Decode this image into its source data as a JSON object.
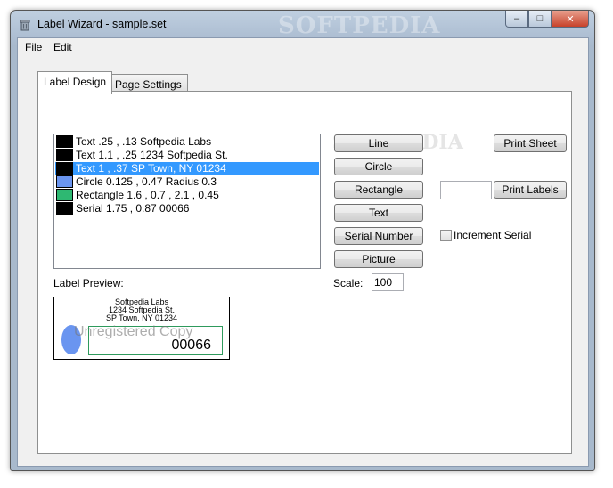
{
  "window": {
    "title": "Label Wizard - sample.set",
    "title_watermark": "SOFTPEDIA",
    "buttons": {
      "minimize": "–",
      "maximize": "□",
      "close": "✕"
    }
  },
  "menu": {
    "items": [
      "File",
      "Edit"
    ]
  },
  "tabs": [
    {
      "label": "Label Design",
      "active": true
    },
    {
      "label": "Page Settings",
      "active": false
    }
  ],
  "list": {
    "items": [
      {
        "text": "Text .25 , .13 Softpedia Labs",
        "color": "#000000",
        "selected": false
      },
      {
        "text": "Text 1.1 , .25 1234 Softpedia St.",
        "color": "#000000",
        "selected": false
      },
      {
        "text": "Text 1 , .37 SP Town, NY 01234",
        "color": "#000000",
        "selected": true
      },
      {
        "text": "Circle 0.125 , 0.47 Radius 0.3",
        "color": "#6a95f0",
        "selected": false
      },
      {
        "text": "Rectangle 1.6 , 0.7 , 2.1 , 0.45",
        "color": "#2eb872",
        "selected": false
      },
      {
        "text": "Serial 1.75 , 0.87 00066",
        "color": "#000000",
        "selected": false
      }
    ]
  },
  "tools": {
    "line": "Line",
    "circle": "Circle",
    "rectangle": "Rectangle",
    "text": "Text",
    "serial_number": "Serial Number",
    "picture": "Picture"
  },
  "scale": {
    "label": "Scale:",
    "value": "100"
  },
  "print": {
    "sheet": "Print Sheet",
    "labels": "Print Labels",
    "labels_count_value": ""
  },
  "increment_serial": {
    "label": "Increment Serial",
    "checked": false
  },
  "preview": {
    "label": "Label Preview:",
    "line1": "Softpedia Labs",
    "line2": "1234 Softpedia St.",
    "line3": "SP Town, NY 01234",
    "serial": "00066",
    "watermark": "Unregistered Copy"
  },
  "softpedia_watermark": "SOFTPEDIA"
}
